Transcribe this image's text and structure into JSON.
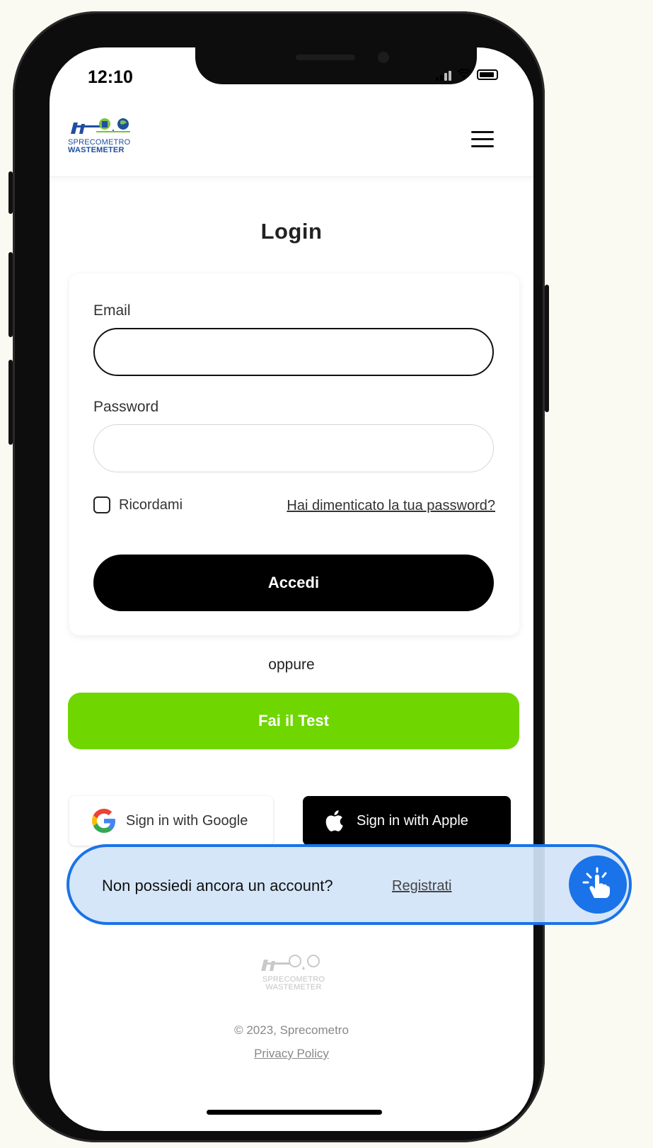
{
  "status_bar": {
    "time": "12:10"
  },
  "header": {
    "logo_line1": "SPRECOMETRO",
    "logo_line2": "WASTEMETER",
    "menu_icon": "hamburger-menu-icon"
  },
  "login": {
    "title": "Login",
    "email_label": "Email",
    "email_value": "",
    "password_label": "Password",
    "password_value": "",
    "remember_label": "Ricordami",
    "remember_checked": false,
    "forgot_link": "Hai dimenticato la tua password?",
    "submit_label": "Accedi"
  },
  "alternatives": {
    "separator": "oppure",
    "test_button": "Fai il Test",
    "google_button": "Sign in with Google",
    "apple_button": "Sign in with Apple"
  },
  "register_prompt": {
    "question": "Non possiedi ancora un account?",
    "link": "Registrati"
  },
  "footer": {
    "logo_line1": "SPRECOMETRO",
    "logo_line2": "WASTEMETER",
    "copyright": "© 2023, Sprecometro",
    "privacy": "Privacy Policy"
  },
  "colors": {
    "accent_green": "#6fd600",
    "highlight_blue": "#1a73e8",
    "brand_blue": "#1f4fa0"
  }
}
